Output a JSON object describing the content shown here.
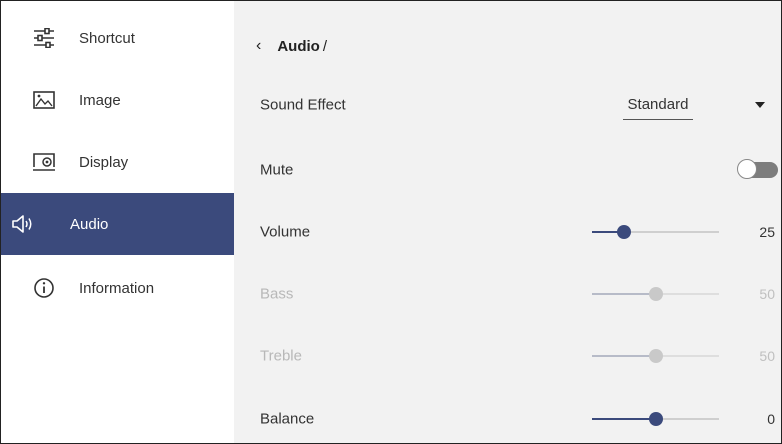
{
  "sidebar": {
    "items": [
      {
        "label": "Shortcut",
        "icon": "sliders-icon"
      },
      {
        "label": "Image",
        "icon": "image-icon"
      },
      {
        "label": "Display",
        "icon": "display-settings-icon"
      },
      {
        "label": "Audio",
        "icon": "speaker-icon",
        "active": true
      },
      {
        "label": "Information",
        "icon": "info-icon"
      }
    ]
  },
  "header": {
    "back_icon": "‹",
    "title": "Audio",
    "separator": "/"
  },
  "settings": {
    "sound_effect": {
      "label": "Sound Effect",
      "value": "Standard"
    },
    "mute": {
      "label": "Mute",
      "on": false
    },
    "volume": {
      "label": "Volume",
      "value": "25",
      "level": 0.25
    },
    "bass": {
      "label": "Bass",
      "value": "50",
      "level": 0.5,
      "disabled": true
    },
    "treble": {
      "label": "Treble",
      "value": "50",
      "level": 0.5,
      "disabled": true
    },
    "balance": {
      "label": "Balance",
      "value": "0",
      "level": 0.5
    }
  },
  "colors": {
    "accent": "#3b4a7c",
    "panel_bg": "#f2f2f2",
    "disabled_text": "#b8b8b8"
  }
}
